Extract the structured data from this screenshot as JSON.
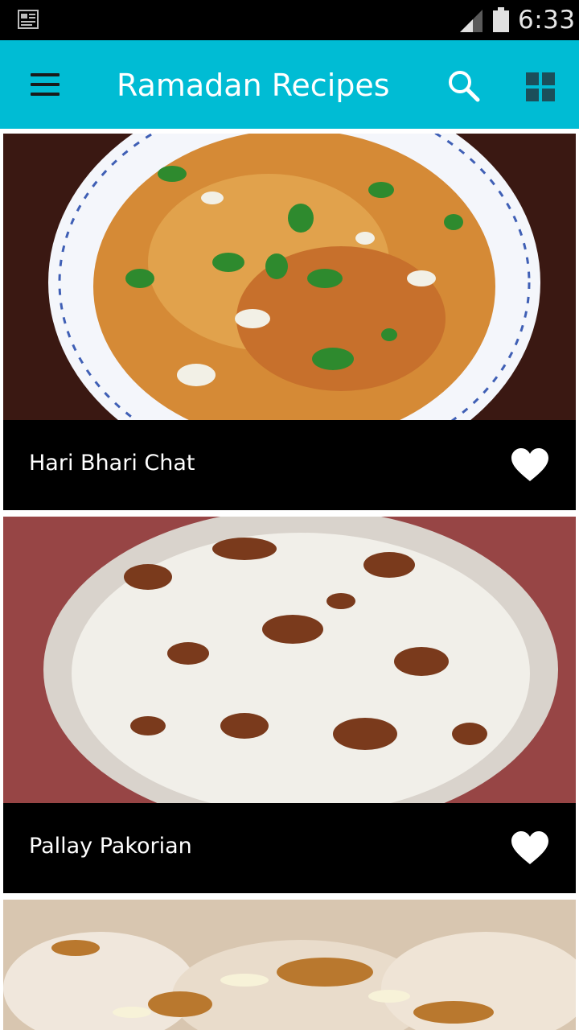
{
  "status_bar": {
    "time": "6:33",
    "icons": [
      "notification-icon",
      "signal-icon",
      "battery-icon"
    ]
  },
  "toolbar": {
    "title": "Ramadan Recipes",
    "icons": [
      "menu-icon",
      "search-icon",
      "grid-view-icon"
    ],
    "background": "#00bcd4"
  },
  "recipes": [
    {
      "title": "Hari Bhari Chat",
      "favorite_icon": "heart-icon"
    },
    {
      "title": "Pallay Pakorian",
      "favorite_icon": "heart-icon"
    }
  ],
  "colors": {
    "accent": "#00bcd4",
    "card_footer": "#000000",
    "text_on_dark": "#ffffff"
  }
}
